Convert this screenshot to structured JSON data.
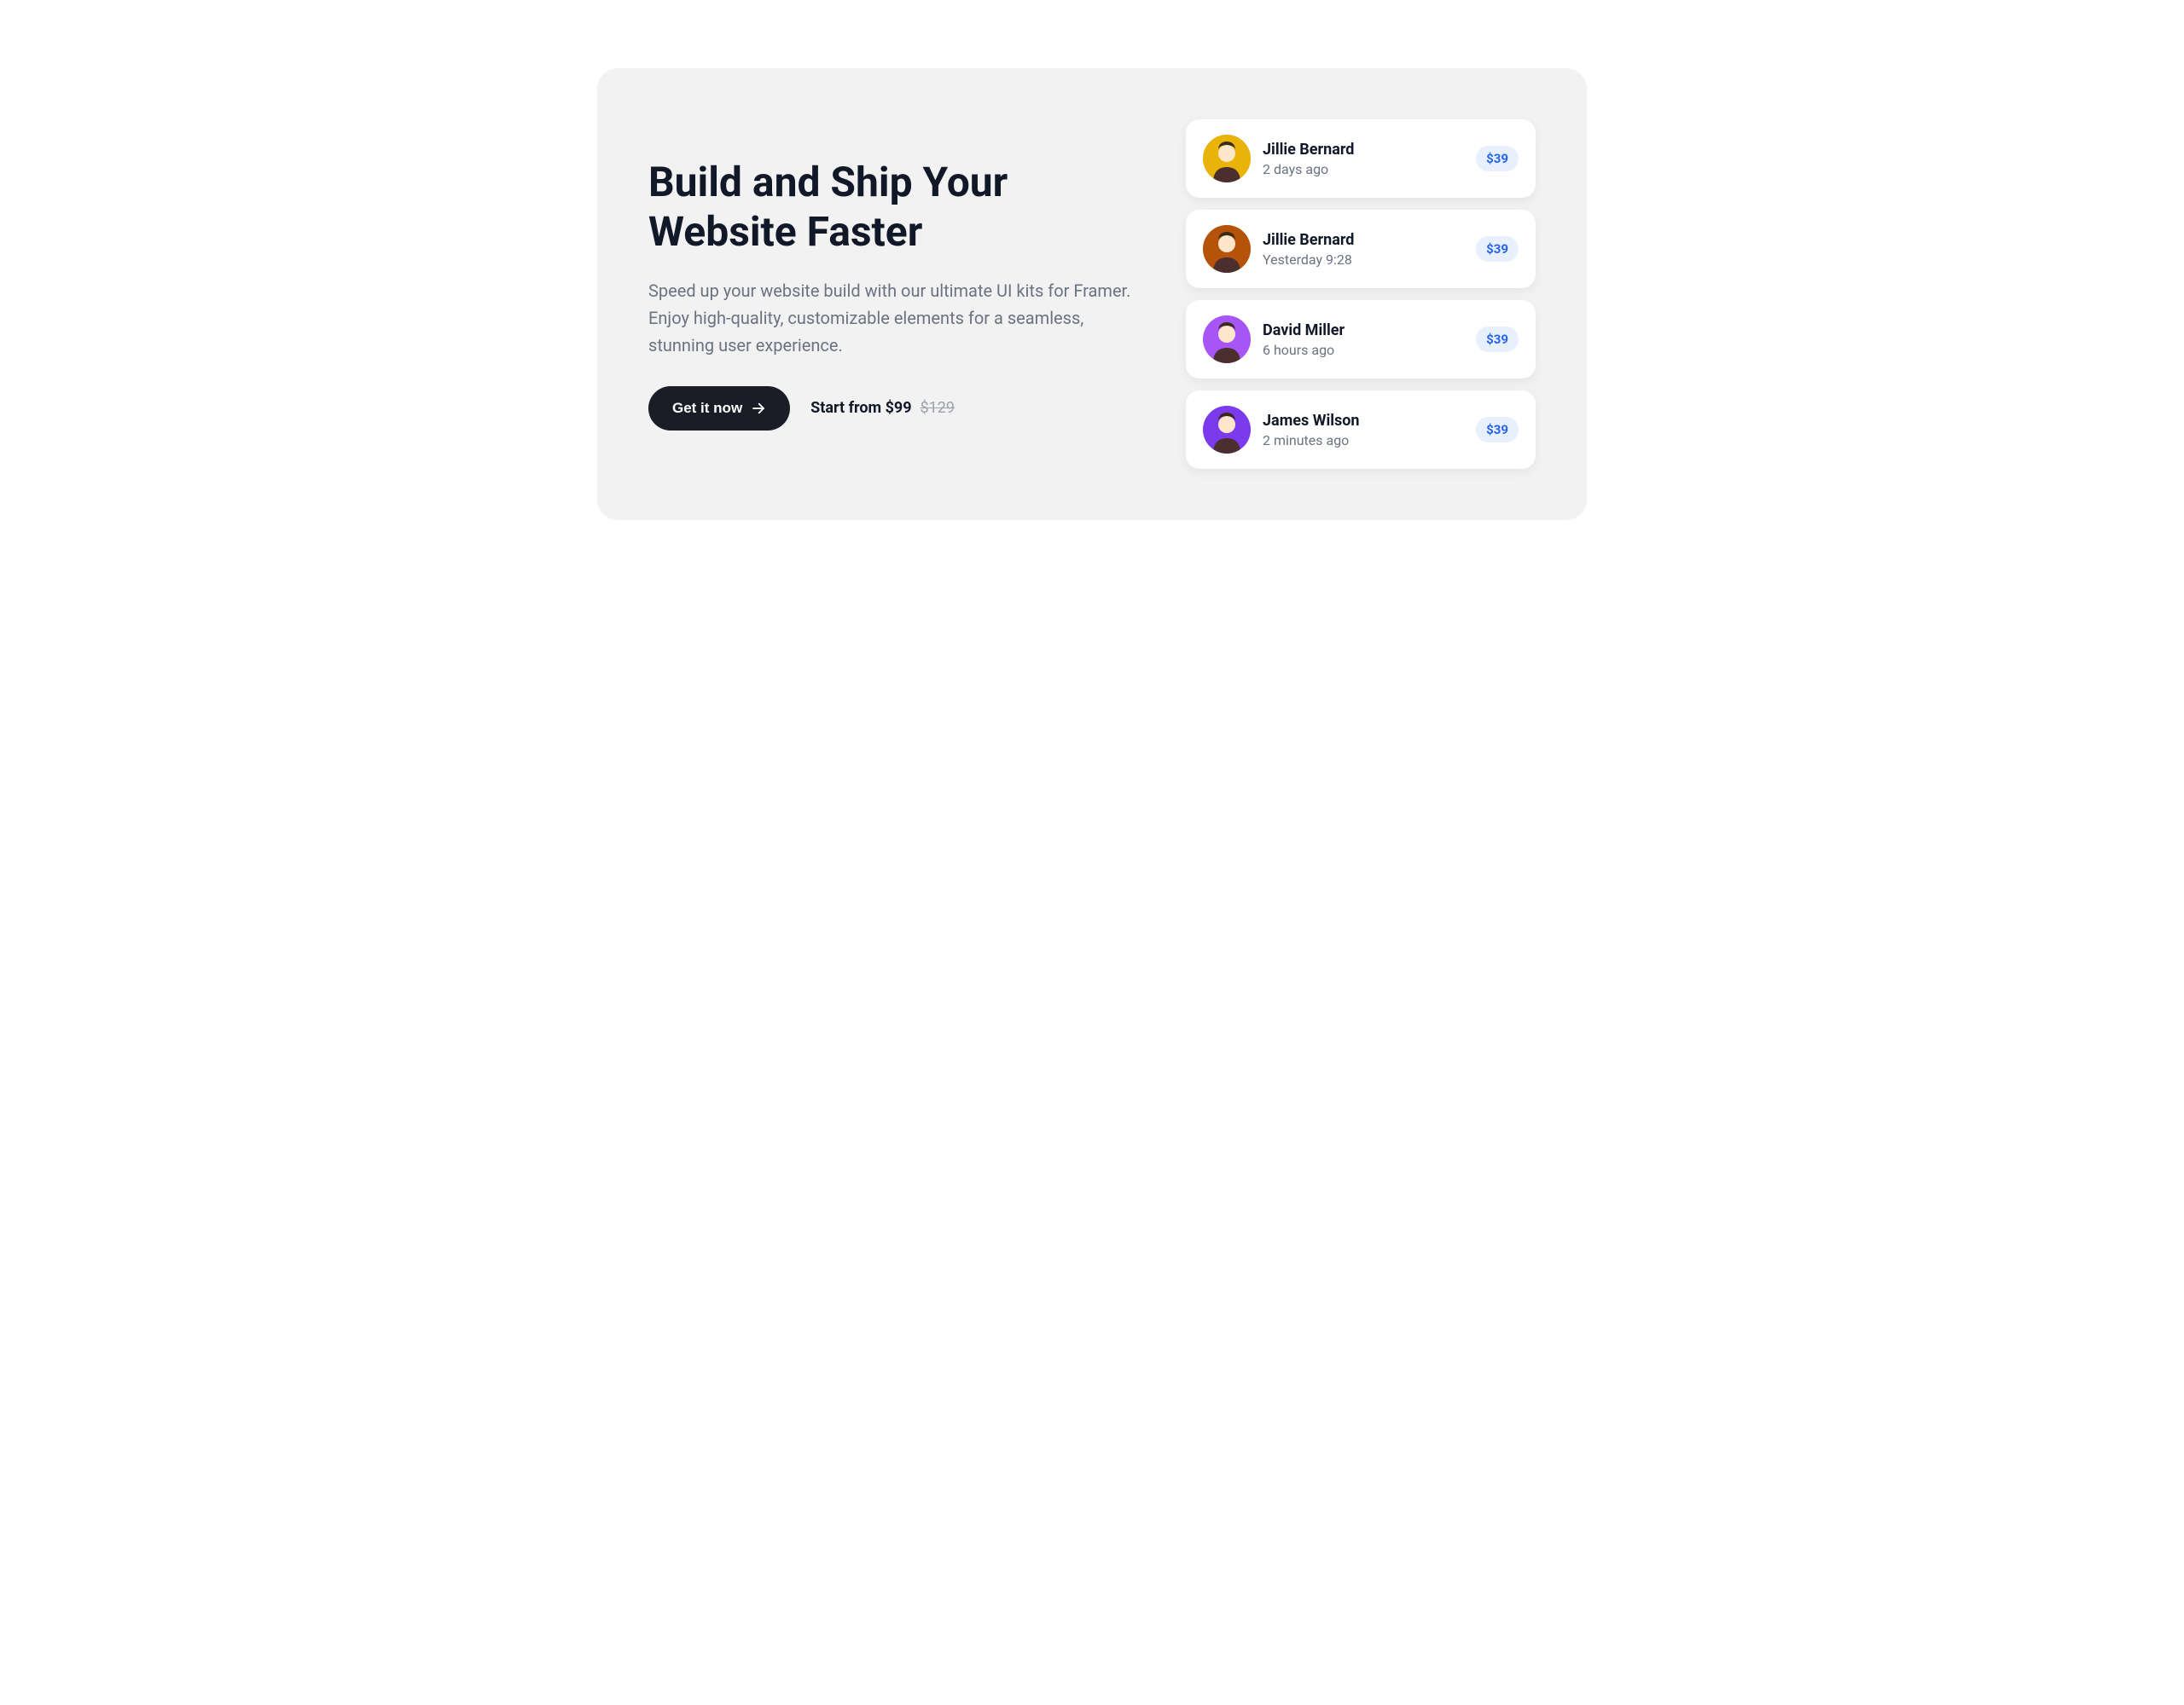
{
  "hero": {
    "title": "Build and Ship Your Website Faster",
    "subtitle": "Speed up your website build with our ultimate UI kits for Framer. Enjoy high-quality, customizable elements for a seamless, stunning user experience.",
    "cta_label": "Get it now",
    "price_current": "Start from $99",
    "price_old": "$129"
  },
  "purchases": [
    {
      "name": "Jillie Bernard",
      "time": "2 days ago",
      "price": "$39"
    },
    {
      "name": "Jillie Bernard",
      "time": "Yesterday 9:28",
      "price": "$39"
    },
    {
      "name": "David Miller",
      "time": "6 hours ago",
      "price": "$39"
    },
    {
      "name": "James Wilson",
      "time": "2 minutes ago",
      "price": "$39"
    }
  ],
  "avatar_colors": [
    "#eab308",
    "#b45309",
    "#a855f7",
    "#7c3aed"
  ]
}
